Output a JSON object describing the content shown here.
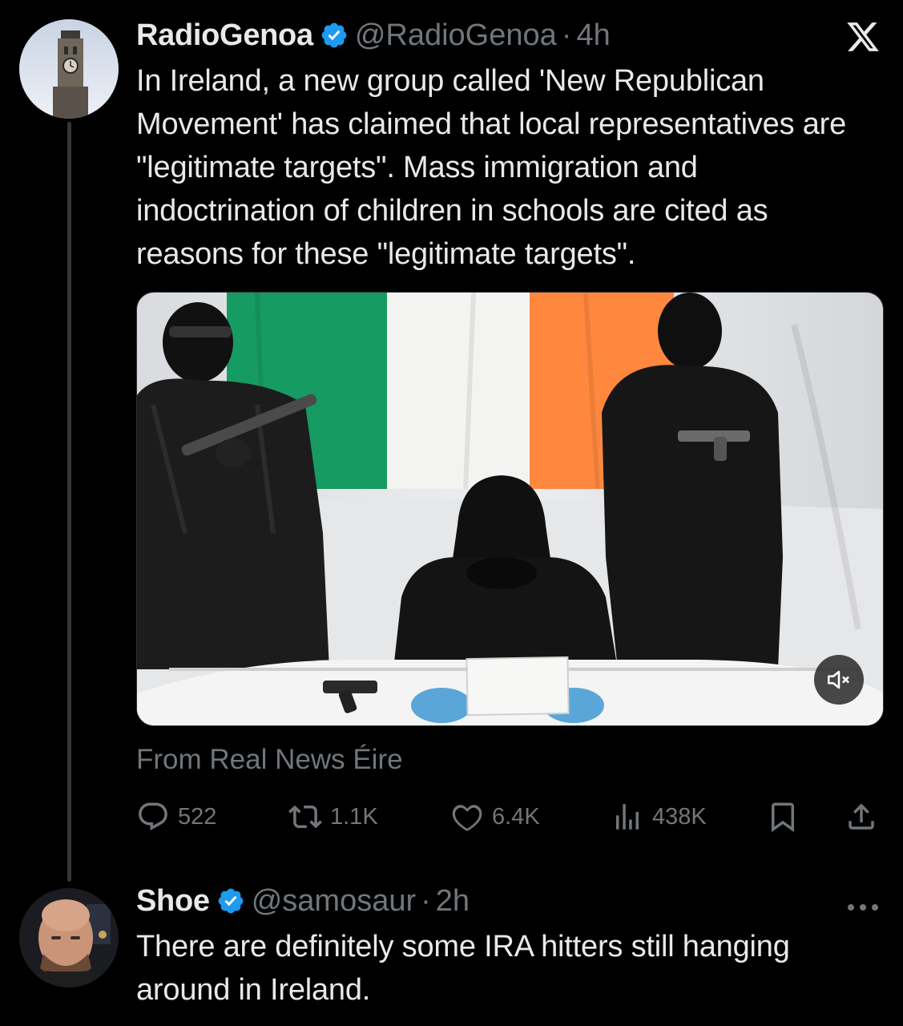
{
  "post1": {
    "display_name": "RadioGenoa",
    "handle": "@RadioGenoa",
    "separator": "·",
    "time": "4h",
    "text": "In Ireland, a new group called 'New Republican Movement' has claimed that local representatives are \"legitimate targets\". Mass immigration and indoctrination of children in schools are cited as reasons for these \"legitimate targets\".",
    "media_attribution": "From Real News Éire",
    "stats": {
      "replies": "522",
      "reposts": "1.1K",
      "likes": "6.4K",
      "views": "438K"
    }
  },
  "post2": {
    "display_name": "Shoe",
    "handle": "@samosaur",
    "separator": "·",
    "time": "2h",
    "text": "There are definitely some IRA hitters still hanging around in Ireland."
  },
  "colors": {
    "background": "#000000",
    "text": "#e7e9ea",
    "muted": "#71767b",
    "verified": "#1d9bf0",
    "flag_green": "#169b62",
    "flag_orange": "#ff883e"
  },
  "icons": {
    "verified": "verified-badge-icon",
    "x_logo": "x-logo-icon",
    "mute": "speaker-muted-icon",
    "reply": "reply-icon",
    "repost": "repost-icon",
    "like": "heart-icon",
    "views": "views-icon",
    "bookmark": "bookmark-icon",
    "share": "share-icon",
    "more": "more-icon"
  }
}
